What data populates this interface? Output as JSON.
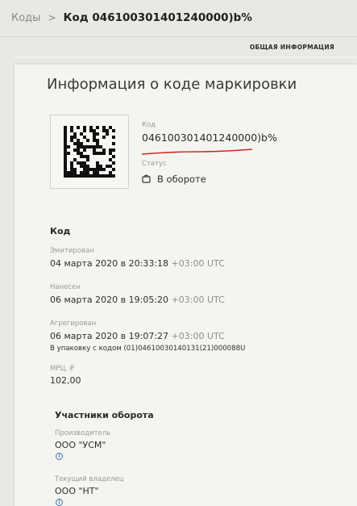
{
  "breadcrumb": {
    "parent": "Коды",
    "separator": ">",
    "current": "Код 046100301401240000)b%"
  },
  "tabs": [
    {
      "label": "ОБЩАЯ ИНФОРМАЦИЯ"
    }
  ],
  "card": {
    "title": "Информация о коде маркировки",
    "code_label": "Код",
    "code_value": "046100301401240000)b%",
    "status_label": "Статус",
    "status_value": "В обороте",
    "status_icon": "bag-icon"
  },
  "code_section": {
    "title": "Код",
    "emitted": {
      "label": "Эмитирован",
      "date": "04 марта 2020 в 20:33:18",
      "tz": "+03:00 UTC"
    },
    "applied": {
      "label": "Нанесен",
      "date": "06 марта 2020 в 19:05:20",
      "tz": "+03:00 UTC"
    },
    "aggregated": {
      "label": "Агрегирован",
      "date": "06 марта 2020 в 19:07:27",
      "tz": "+03:00 UTC",
      "package_line": "В упаковку с кодом (01)04610030140131(21)000088U"
    },
    "mrp": {
      "label": "МРЦ, ₽",
      "value": "102,00"
    }
  },
  "participants": {
    "title": "Участники оборота",
    "items": [
      {
        "label": "Производитель",
        "value": "ООО \"УСМ\""
      },
      {
        "label": "Текущий владелец",
        "value": "ООО \"НТ\""
      }
    ]
  },
  "colors": {
    "accent_underline": "#c8271f",
    "info_blue": "#3b6fb6"
  }
}
